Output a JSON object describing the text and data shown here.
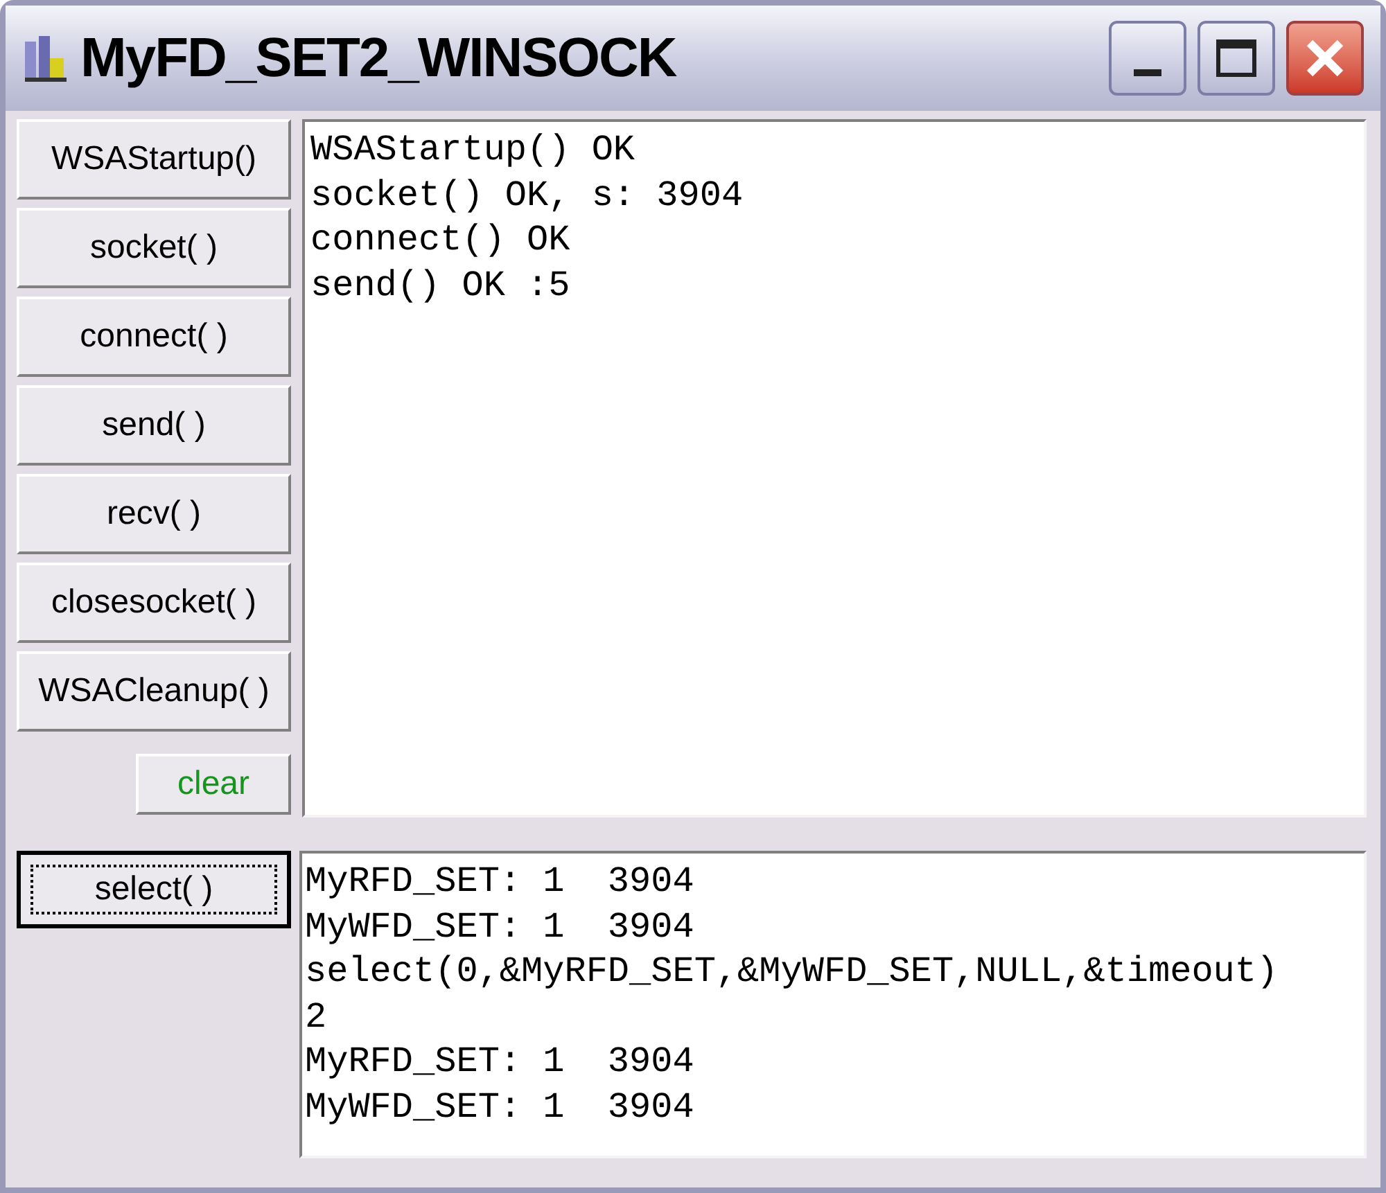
{
  "window": {
    "title": "MyFD_SET2_WINSOCK"
  },
  "buttons": [
    {
      "label": "WSAStartup()"
    },
    {
      "label": "socket( )"
    },
    {
      "label": "connect( )"
    },
    {
      "label": "send( )"
    },
    {
      "label": "recv( )"
    },
    {
      "label": "closesocket( )"
    },
    {
      "label": "WSACleanup( )"
    }
  ],
  "clear_button": {
    "label": "clear"
  },
  "select_button": {
    "label": "select( )",
    "focused": true
  },
  "top_log": [
    "WSAStartup() OK",
    "socket() OK, s: 3904",
    "connect() OK",
    "send() OK :5"
  ],
  "bottom_log": [
    "MyRFD_SET: 1  3904",
    "MyWFD_SET: 1  3904",
    "select(0,&MyRFD_SET,&MyWFD_SET,NULL,&timeout)",
    "2",
    "MyRFD_SET: 1  3904",
    "MyWFD_SET: 1  3904"
  ]
}
